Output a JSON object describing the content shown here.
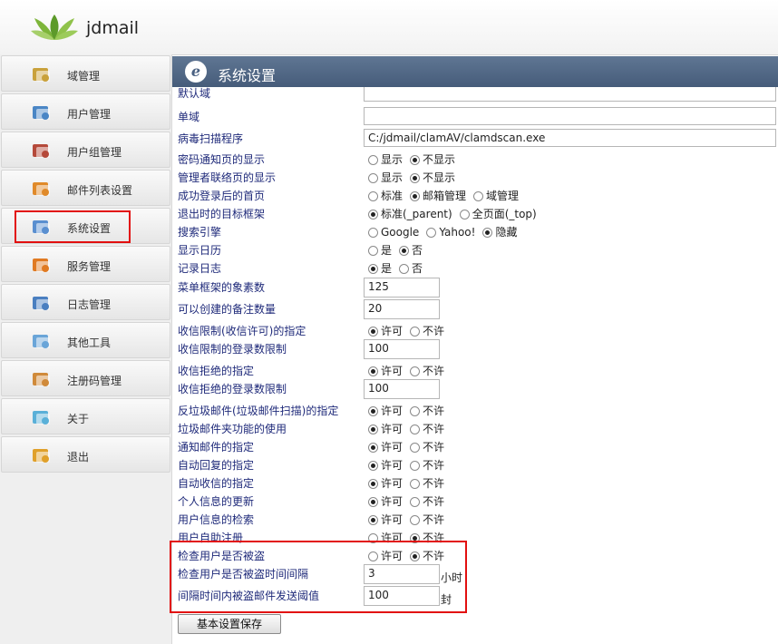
{
  "app": {
    "name": "jdmail"
  },
  "sidebar": {
    "items": [
      {
        "label": "域管理",
        "icon": "domain-icon"
      },
      {
        "label": "用户管理",
        "icon": "user-icon"
      },
      {
        "label": "用户组管理",
        "icon": "group-icon"
      },
      {
        "label": "邮件列表设置",
        "icon": "mailing-list-icon"
      },
      {
        "label": "系统设置",
        "icon": "settings-icon"
      },
      {
        "label": "服务管理",
        "icon": "service-icon"
      },
      {
        "label": "日志管理",
        "icon": "log-icon"
      },
      {
        "label": "其他工具",
        "icon": "tools-icon"
      },
      {
        "label": "注册码管理",
        "icon": "license-icon"
      },
      {
        "label": "关于",
        "icon": "about-icon"
      },
      {
        "label": "退出",
        "icon": "logout-icon"
      }
    ]
  },
  "page": {
    "title": "系统设置",
    "badge": "e"
  },
  "form": {
    "default_domain": {
      "label": "默认域",
      "value": ""
    },
    "single_domain": {
      "label": "单域",
      "value": ""
    },
    "virus_scanner": {
      "label": "病毒扫描程序",
      "value": "C:/jdmail/clamAV/clamdscan.exe"
    },
    "password_notice": {
      "label": "密码通知页的显示",
      "options": [
        "显示",
        "不显示"
      ],
      "selected": "不显示"
    },
    "admin_contact": {
      "label": "管理者联络页的显示",
      "options": [
        "显示",
        "不显示"
      ],
      "selected": "不显示"
    },
    "home_after_login": {
      "label": "成功登录后的首页",
      "options": [
        "标准",
        "邮箱管理",
        "域管理"
      ],
      "selected": "邮箱管理"
    },
    "logout_target": {
      "label": "退出时的目标框架",
      "options": [
        "标准(_parent)",
        "全页面(_top)"
      ],
      "selected": "标准(_parent)"
    },
    "search_engine": {
      "label": "搜索引擎",
      "options": [
        "Google",
        "Yahoo!",
        "隐藏"
      ],
      "selected": "隐藏"
    },
    "show_calendar": {
      "label": "显示日历",
      "options": [
        "是",
        "否"
      ],
      "selected": "否"
    },
    "record_log": {
      "label": "记录日志",
      "options": [
        "是",
        "否"
      ],
      "selected": "是"
    },
    "menu_frame_px": {
      "label": "菜单框架的象素数",
      "value": "125"
    },
    "memo_count": {
      "label": "可以创建的备注数量",
      "value": "20"
    },
    "receive_limit": {
      "label": "收信限制(收信许可)的指定",
      "options": [
        "许可",
        "不许"
      ],
      "selected": "许可"
    },
    "receive_limit_count": {
      "label": "收信限制的登录数限制",
      "value": "100"
    },
    "reject": {
      "label": "收信拒绝的指定",
      "options": [
        "许可",
        "不许"
      ],
      "selected": "许可"
    },
    "reject_count": {
      "label": "收信拒绝的登录数限制",
      "value": "100"
    },
    "anti_spam": {
      "label": "反垃圾邮件(垃圾邮件扫描)的指定",
      "options": [
        "许可",
        "不许"
      ],
      "selected": "许可"
    },
    "spam_folder": {
      "label": "垃圾邮件夹功能的使用",
      "options": [
        "许可",
        "不许"
      ],
      "selected": "许可"
    },
    "notify_mail": {
      "label": "通知邮件的指定",
      "options": [
        "许可",
        "不许"
      ],
      "selected": "许可"
    },
    "auto_reply": {
      "label": "自动回复的指定",
      "options": [
        "许可",
        "不许"
      ],
      "selected": "许可"
    },
    "auto_receive": {
      "label": "自动收信的指定",
      "options": [
        "许可",
        "不许"
      ],
      "selected": "许可"
    },
    "personal_update": {
      "label": "个人信息的更新",
      "options": [
        "许可",
        "不许"
      ],
      "selected": "许可"
    },
    "user_search": {
      "label": "用户信息的检索",
      "options": [
        "许可",
        "不许"
      ],
      "selected": "许可"
    },
    "self_register": {
      "label": "用户自助注册",
      "options": [
        "许可",
        "不许"
      ],
      "selected": "不许"
    },
    "check_stolen": {
      "label": "检查用户是否被盗",
      "options": [
        "许可",
        "不许"
      ],
      "selected": "不许"
    },
    "check_interval": {
      "label": "检查用户是否被盗时间间隔",
      "value": "3",
      "unit": "小时"
    },
    "threshold": {
      "label": "间隔时间内被盗邮件发送阈值",
      "value": "100",
      "unit": "封"
    }
  },
  "buttons": {
    "save": "基本设置保存"
  }
}
